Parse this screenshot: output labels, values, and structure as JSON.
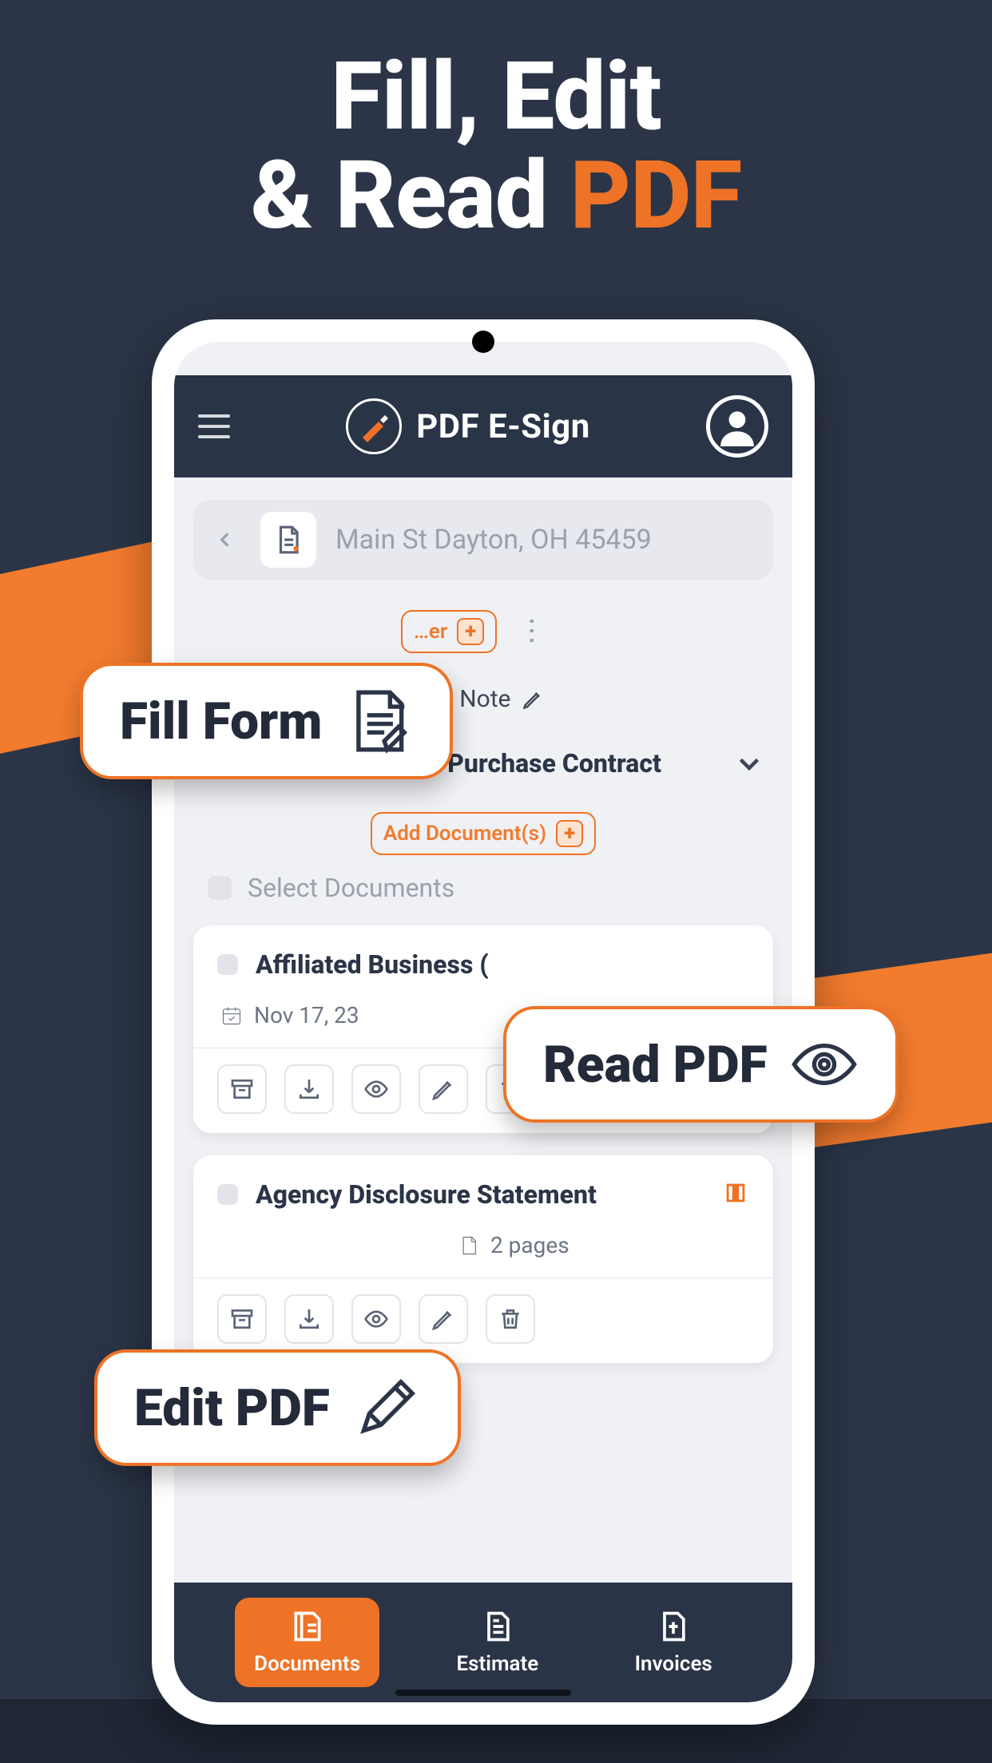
{
  "hero": {
    "line1": "Fill, Edit",
    "line2_pre": "& Read ",
    "line2_accent": "PDF"
  },
  "app": {
    "title": "PDF E-Sign",
    "address": "Main St Dayton, OH 45459",
    "add_folder_label": "…er",
    "note_label": "…te Note",
    "folder_title": "Dayton Residential Purchase Contract",
    "add_documents_label": "Add Document(s)",
    "select_documents_label": "Select Documents"
  },
  "documents": [
    {
      "name": "Affiliated Business (",
      "date": "Nov 17, 23",
      "pages_label": ""
    },
    {
      "name": "Agency Disclosure Statement",
      "date": "",
      "pages_label": "2 pages"
    }
  ],
  "nav": {
    "documents": "Documents",
    "estimate": "Estimate",
    "invoices": "Invoices"
  },
  "callouts": {
    "fill_form": "Fill Form",
    "read_pdf": "Read PDF",
    "edit_pdf": "Edit PDF"
  }
}
